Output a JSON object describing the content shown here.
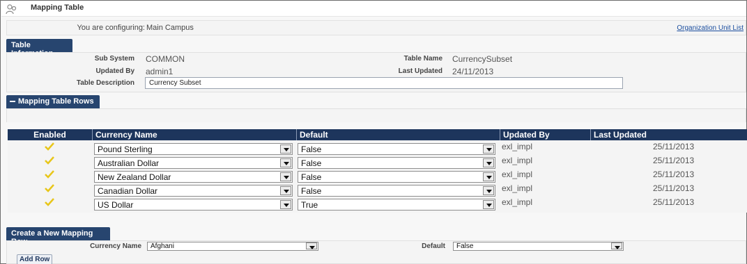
{
  "app": {
    "title": "Mapping Table"
  },
  "configuring": {
    "label": "You are configuring:",
    "value": "Main Campus",
    "link": "Organization Unit List"
  },
  "table_info": {
    "header": "Table Information",
    "sub_system_label": "Sub System",
    "sub_system": "COMMON",
    "updated_by_label": "Updated By",
    "updated_by": "admin1",
    "description_label": "Table Description",
    "description": "Currency Subset",
    "table_name_label": "Table Name",
    "table_name": "CurrencySubset",
    "last_updated_label": "Last Updated",
    "last_updated": "24/11/2013"
  },
  "rows_section": {
    "header": "Mapping Table Rows",
    "collapse_icon": "minus-icon",
    "columns": [
      "Enabled",
      "Currency Name",
      "Default",
      "Updated By",
      "Last Updated"
    ],
    "rows": [
      {
        "enabled": true,
        "currency": "Pound Sterling",
        "default": "False",
        "updated_by": "exl_impl",
        "last_updated": "25/11/2013"
      },
      {
        "enabled": true,
        "currency": "Australian Dollar",
        "default": "False",
        "updated_by": "exl_impl",
        "last_updated": "25/11/2013"
      },
      {
        "enabled": true,
        "currency": "New Zealand Dollar",
        "default": "False",
        "updated_by": "exl_impl",
        "last_updated": "25/11/2013"
      },
      {
        "enabled": true,
        "currency": "Canadian Dollar",
        "default": "False",
        "updated_by": "exl_impl",
        "last_updated": "25/11/2013"
      },
      {
        "enabled": true,
        "currency": "US Dollar",
        "default": "True",
        "updated_by": "exl_impl",
        "last_updated": "25/11/2013"
      }
    ]
  },
  "new_row": {
    "header": "Create a New Mapping Row",
    "currency_label": "Currency Name",
    "currency_value": "Afghani",
    "default_label": "Default",
    "default_value": "False",
    "add_button": "Add Row"
  },
  "colors": {
    "header_bg": "#27456f",
    "grid_header_bg": "#1d355c",
    "check": "#e8c61a",
    "link": "#1a4d9e"
  }
}
